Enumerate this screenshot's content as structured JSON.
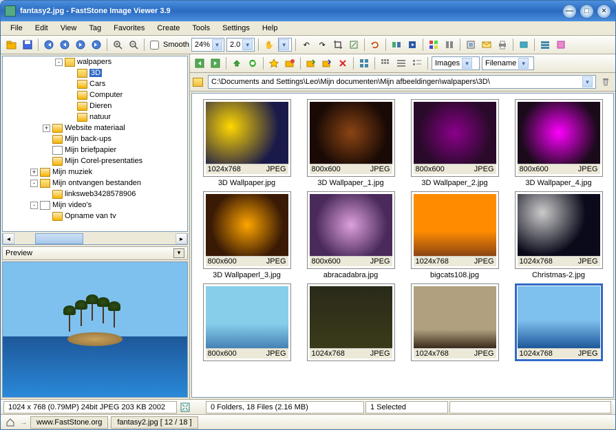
{
  "title": "fantasy2.jpg  -  FastStone Image Viewer 3.9",
  "menu": [
    "File",
    "Edit",
    "View",
    "Tag",
    "Favorites",
    "Create",
    "Tools",
    "Settings",
    "Help"
  ],
  "toolbar": {
    "smooth_label": "Smooth",
    "zoom_pct": "24%",
    "zoom_factor": "2.0"
  },
  "tree": [
    {
      "indent": 2,
      "exp": "-",
      "icon": "folderopen",
      "label": "walpapers"
    },
    {
      "indent": 3,
      "exp": "",
      "icon": "folderopen",
      "label": "3D",
      "selected": true
    },
    {
      "indent": 3,
      "exp": "",
      "icon": "folder",
      "label": "Cars"
    },
    {
      "indent": 3,
      "exp": "",
      "icon": "folder",
      "label": "Computer"
    },
    {
      "indent": 3,
      "exp": "",
      "icon": "folder",
      "label": "Dieren"
    },
    {
      "indent": 3,
      "exp": "",
      "icon": "folder",
      "label": "natuur"
    },
    {
      "indent": 1,
      "exp": "+",
      "icon": "folder",
      "label": "Website materiaal"
    },
    {
      "indent": 1,
      "exp": "",
      "icon": "folder",
      "label": "Mijn back-ups"
    },
    {
      "indent": 1,
      "exp": "",
      "icon": "doc",
      "label": "Mijn briefpapier"
    },
    {
      "indent": 1,
      "exp": "",
      "icon": "folder",
      "label": "Mijn Corel-presentaties"
    },
    {
      "indent": 0,
      "exp": "+",
      "icon": "folder",
      "label": "Mijn muziek"
    },
    {
      "indent": 0,
      "exp": "-",
      "icon": "folderopen",
      "label": "Mijn ontvangen bestanden"
    },
    {
      "indent": 1,
      "exp": "",
      "icon": "folder",
      "label": "linksweb3428578906"
    },
    {
      "indent": 0,
      "exp": "-",
      "icon": "doc",
      "label": "Mijn video's"
    },
    {
      "indent": 1,
      "exp": "",
      "icon": "folder",
      "label": "Opname van tv"
    }
  ],
  "preview_label": "Preview",
  "right_toolbar": {
    "view_mode": "Images",
    "sort_by": "Filename"
  },
  "path": "C:\\Documents and Settings\\Leo\\Mijn documenten\\Mijn afbeeldingen\\walpapers\\3D\\",
  "thumbs": [
    {
      "res": "1024x768",
      "fmt": "JPEG",
      "name": "3D Wallpaper.jpg",
      "bg": "radial-gradient(circle at 30% 40%, #ffd700, #1a1a4a 70%)"
    },
    {
      "res": "800x600",
      "fmt": "JPEG",
      "name": "3D Wallpaper_1.jpg",
      "bg": "radial-gradient(circle at 50% 50%, #8b4513, #1a0a05 70%)"
    },
    {
      "res": "800x600",
      "fmt": "JPEG",
      "name": "3D Wallpaper_2.jpg",
      "bg": "radial-gradient(circle at 50% 50%, #8b008b, #2a0a2a 70%)"
    },
    {
      "res": "800x600",
      "fmt": "JPEG",
      "name": "3D Wallpaper_4.jpg",
      "bg": "radial-gradient(circle at 50% 50%, #ff00ff, #1a0a1a 75%)"
    },
    {
      "res": "800x600",
      "fmt": "JPEG",
      "name": "3D Wallpaperl_3.jpg",
      "bg": "radial-gradient(circle at 50% 50%, #ffa500, #3a1a05 70%)"
    },
    {
      "res": "800x600",
      "fmt": "JPEG",
      "name": "abracadabra.jpg",
      "bg": "radial-gradient(circle at 50% 50%, #dda0dd, #4a2a5a 70%)"
    },
    {
      "res": "1024x768",
      "fmt": "JPEG",
      "name": "bigcats108.jpg",
      "bg": "linear-gradient(#ff8c00 60%, #8b4513)"
    },
    {
      "res": "1024x768",
      "fmt": "JPEG",
      "name": "Christmas-2.jpg",
      "bg": "radial-gradient(circle at 30% 30%, #ccc, #0a0a1a 60%)"
    },
    {
      "res": "800x600",
      "fmt": "JPEG",
      "name": "",
      "bg": "linear-gradient(#87ceeb 60%, #4682b4)"
    },
    {
      "res": "1024x768",
      "fmt": "JPEG",
      "name": "",
      "bg": "linear-gradient(#2a2a1a, #3a3a1a)"
    },
    {
      "res": "1024x768",
      "fmt": "JPEG",
      "name": "",
      "bg": "linear-gradient(#b0a080 70%, #3a2a1a)"
    },
    {
      "res": "1024x768",
      "fmt": "JPEG",
      "name": "",
      "bg": "linear-gradient(#7ec0ee 55%, #1e5799)",
      "selected": true
    }
  ],
  "status": {
    "left": "1024 x 768 (0.79MP)   24bit JPEG   203 KB   2002",
    "folders_files": "0 Folders, 18 Files (2.16 MB)",
    "selected": "1 Selected"
  },
  "bottom": {
    "url": "www.FastStone.org",
    "file_index": "fantasy2.jpg [ 12 / 18 ]"
  }
}
